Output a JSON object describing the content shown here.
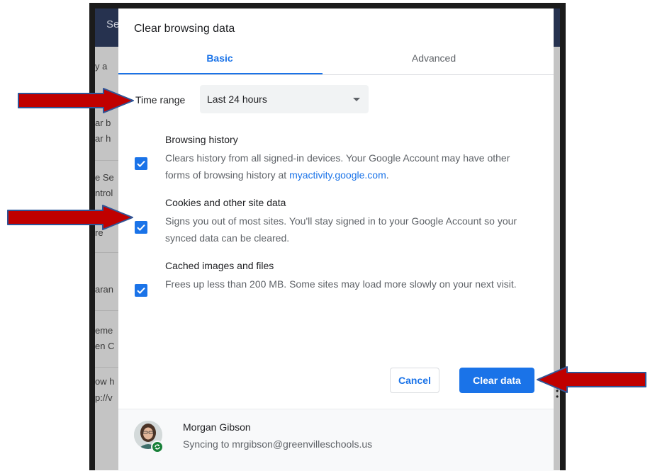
{
  "background": {
    "header_text": "Se",
    "partial_texts": [
      "y a",
      "ar b",
      "ar h",
      "e Se",
      "ntrol",
      "re",
      "aran",
      "eme",
      "en C",
      "ow h",
      "p://v"
    ]
  },
  "dialog": {
    "title": "Clear browsing data",
    "tabs": [
      {
        "label": "Basic",
        "selected": true
      },
      {
        "label": "Advanced",
        "selected": false
      }
    ],
    "time_range": {
      "label": "Time range",
      "value": "Last 24 hours"
    },
    "options": [
      {
        "title": "Browsing history",
        "desc_before_link": "Clears history from all signed-in devices. Your Google Account may have other forms of browsing history at ",
        "link": "myactivity.google.com",
        "desc_after_link": ".",
        "checked": true
      },
      {
        "title": "Cookies and other site data",
        "desc": "Signs you out of most sites. You'll stay signed in to your Google Account so your synced data can be cleared.",
        "checked": true
      },
      {
        "title": "Cached images and files",
        "desc": "Frees up less than 200 MB. Some sites may load more slowly on your next visit.",
        "checked": true
      }
    ],
    "buttons": {
      "cancel": "Cancel",
      "clear": "Clear data"
    },
    "account": {
      "name": "Morgan Gibson",
      "sync_text": "Syncing to mrgibson@greenvilleschools.us"
    }
  },
  "colors": {
    "accent": "#1a73e8",
    "arrow_fill": "#c00000",
    "arrow_stroke": "#2f5597",
    "sync_badge": "#188038"
  },
  "icons": [
    "check-icon",
    "dropdown-caret-icon",
    "sync-icon",
    "annotation-arrow-icon"
  ]
}
